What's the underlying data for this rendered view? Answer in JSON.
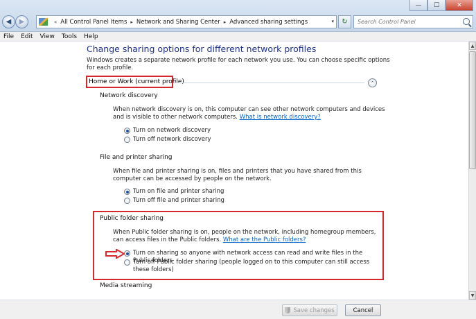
{
  "window": {
    "minimize_glyph": "—",
    "maximize_glyph": "☐",
    "close_glyph": "✕"
  },
  "nav": {
    "back_glyph": "◀",
    "forward_glyph": "▶",
    "recent_glyph": "▾",
    "refresh_glyph": "↻"
  },
  "address": {
    "crumbs": [
      "All Control Panel Items",
      "Network and Sharing Center",
      "Advanced sharing settings"
    ],
    "lead_sep": "«",
    "sep": "▸",
    "dropdown_glyph": "▾"
  },
  "search": {
    "placeholder": "Search Control Panel"
  },
  "menu": [
    "File",
    "Edit",
    "View",
    "Tools",
    "Help"
  ],
  "page": {
    "title": "Change sharing options for different network profiles",
    "intro": "Windows creates a separate network profile for each network you use. You can choose specific options for each profile."
  },
  "profile": {
    "label": "Home or Work (current profile)",
    "collapse_glyph": "⌃"
  },
  "network_discovery": {
    "heading": "Network discovery",
    "description": "When network discovery is on, this computer can see other network computers and devices and is visible to other network computers.",
    "link": "What is network discovery?",
    "options": [
      {
        "label": "Turn on network discovery",
        "selected": true
      },
      {
        "label": "Turn off network discovery",
        "selected": false
      }
    ]
  },
  "file_printer": {
    "heading": "File and printer sharing",
    "description": "When file and printer sharing is on, files and printers that you have shared from this computer can be accessed by people on the network.",
    "options": [
      {
        "label": "Turn on file and printer sharing",
        "selected": true
      },
      {
        "label": "Turn off file and printer sharing",
        "selected": false
      }
    ]
  },
  "public_folder": {
    "heading": "Public folder sharing",
    "description": "When Public folder sharing is on, people on the network, including homegroup members, can access files in the Public folders.",
    "link": "What are the Public folders?",
    "options": [
      {
        "label": "Turn on sharing so anyone with network access can read and write files in the Public folders",
        "selected": true
      },
      {
        "label": "Turn off Public folder sharing (people logged on to this computer can still access these folders)",
        "selected": false
      }
    ]
  },
  "media": {
    "heading": "Media streaming"
  },
  "scrollbar": {
    "up_glyph": "▲",
    "down_glyph": "▼"
  },
  "footer": {
    "save_label": "Save changes",
    "cancel_label": "Cancel"
  },
  "colors": {
    "highlight_red": "#d7272c",
    "title_blue": "#1e3287",
    "link_blue": "#0066cc"
  }
}
